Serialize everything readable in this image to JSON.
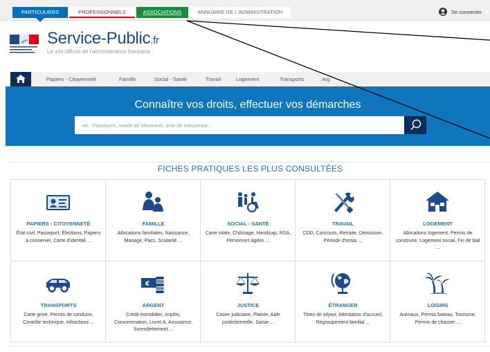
{
  "audience_tabs": [
    {
      "label": "PARTICULIERS"
    },
    {
      "label": "PROFESSIONNELS"
    },
    {
      "label": "ASSOCIATIONS"
    },
    {
      "label": "ANNUAIRE DE L'ADMINISTRATION"
    }
  ],
  "connect_label": "Se connecter",
  "logo": {
    "title": "Service-Public",
    "suffix": ".fr",
    "subtitle": "Le site officiel de l'administration française"
  },
  "nav": {
    "items": [
      "Papiers - Citoyenneté",
      "Famille",
      "Social - Santé",
      "Travail",
      "Logement",
      "Transports",
      "Arg"
    ]
  },
  "search": {
    "title": "Connaître vos droits, effectuer vos démarches",
    "placeholder": "ex.: Passeport, mairie de Montreuil, acte de naissance..."
  },
  "section_title": "FICHES PRATIQUES LES PLUS CONSULTÉES",
  "categories": [
    {
      "name": "PAPIERS - CITOYENNETÉ",
      "desc": "État-civil, Passeport, Élections, Papiers à conserver, Carte d'identité ...",
      "icon": "id-card-icon"
    },
    {
      "name": "FAMILLE",
      "desc": "Allocations familiales, Naissance, Mariage, Pacs, Scolarité ...",
      "icon": "family-icon"
    },
    {
      "name": "SOCIAL - SANTÉ",
      "desc": "Carte vitale, Chômage, Handicap, RSA, Personnes âgées ...",
      "icon": "wheelchair-icon"
    },
    {
      "name": "TRAVAIL",
      "desc": "CDD, Concours, Retraite, Démission, Période d'essai ...",
      "icon": "tools-icon"
    },
    {
      "name": "LOGEMENT",
      "desc": "Allocations logement, Permis de construire, Logement social, Fin de bail ...",
      "icon": "house-icon"
    },
    {
      "name": "TRANSPORTS",
      "desc": "Carte grise, Permis de conduire, Contrôle technique, Infractions ...",
      "icon": "car-icon"
    },
    {
      "name": "ARGENT",
      "desc": "Crédit immobilier, Impôts, Consommation, Livret A, Assurance, Surendettement ...",
      "icon": "money-icon"
    },
    {
      "name": "JUSTICE",
      "desc": "Casier judiciaire, Plainte, Aide juridictionnelle, Saisie ...",
      "icon": "scales-icon"
    },
    {
      "name": "ÉTRANGER",
      "desc": "Titres de séjour, Attestation d'accueil, Regroupement familial ...",
      "icon": "globe-icon"
    },
    {
      "name": "LOISIRS",
      "desc": "Animaux, Permis bateau, Tourisme, Permis de chasser ...",
      "icon": "palm-tree-icon"
    }
  ],
  "colors": {
    "particuliers": "#0b6fb8",
    "professionnels": "#c8102e",
    "associations": "#1e8a3c",
    "band": "#0f75bc",
    "navy": "#0a2e57",
    "link": "#1b75bc"
  }
}
